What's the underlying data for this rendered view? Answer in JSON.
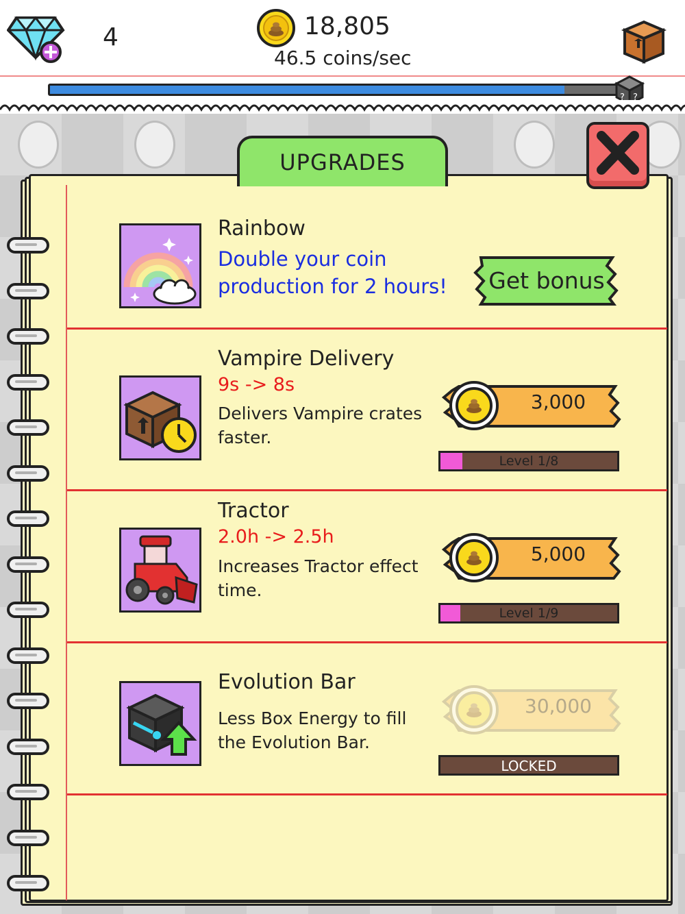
{
  "hud": {
    "gem_count": "4",
    "coins": "18,805",
    "coin_rate": "46.5 coins/sec",
    "evolution_progress": 0.9
  },
  "panel": {
    "title": "UPGRADES"
  },
  "upgrades": [
    {
      "title": "Rainbow",
      "description": "Double your coin production for 2 hours!",
      "button_label": "Get bonus",
      "icon": "rainbow-icon"
    },
    {
      "title": "Vampire Delivery",
      "change": "9s -> 8s",
      "description": "Delivers Vampire crates faster.",
      "cost": "3,000",
      "level_text": "Level 1/8",
      "level_progress": 0.125,
      "icon": "crate-clock-icon"
    },
    {
      "title": "Tractor",
      "change": "2.0h -> 2.5h",
      "description": "Increases Tractor effect time.",
      "cost": "5,000",
      "level_text": "Level 1/9",
      "level_progress": 0.111,
      "icon": "tractor-icon"
    },
    {
      "title": "Evolution Bar",
      "description": "Less Box Energy to fill the Evolution Bar.",
      "cost": "30,000",
      "status": "LOCKED",
      "icon": "evolution-box-icon"
    }
  ],
  "colors": {
    "accent_green": "#8fe56a",
    "close_red": "#f26b6b",
    "cost_orange": "#f8b54c",
    "level_pink": "#f15ad7",
    "separator_red": "#e23131"
  }
}
